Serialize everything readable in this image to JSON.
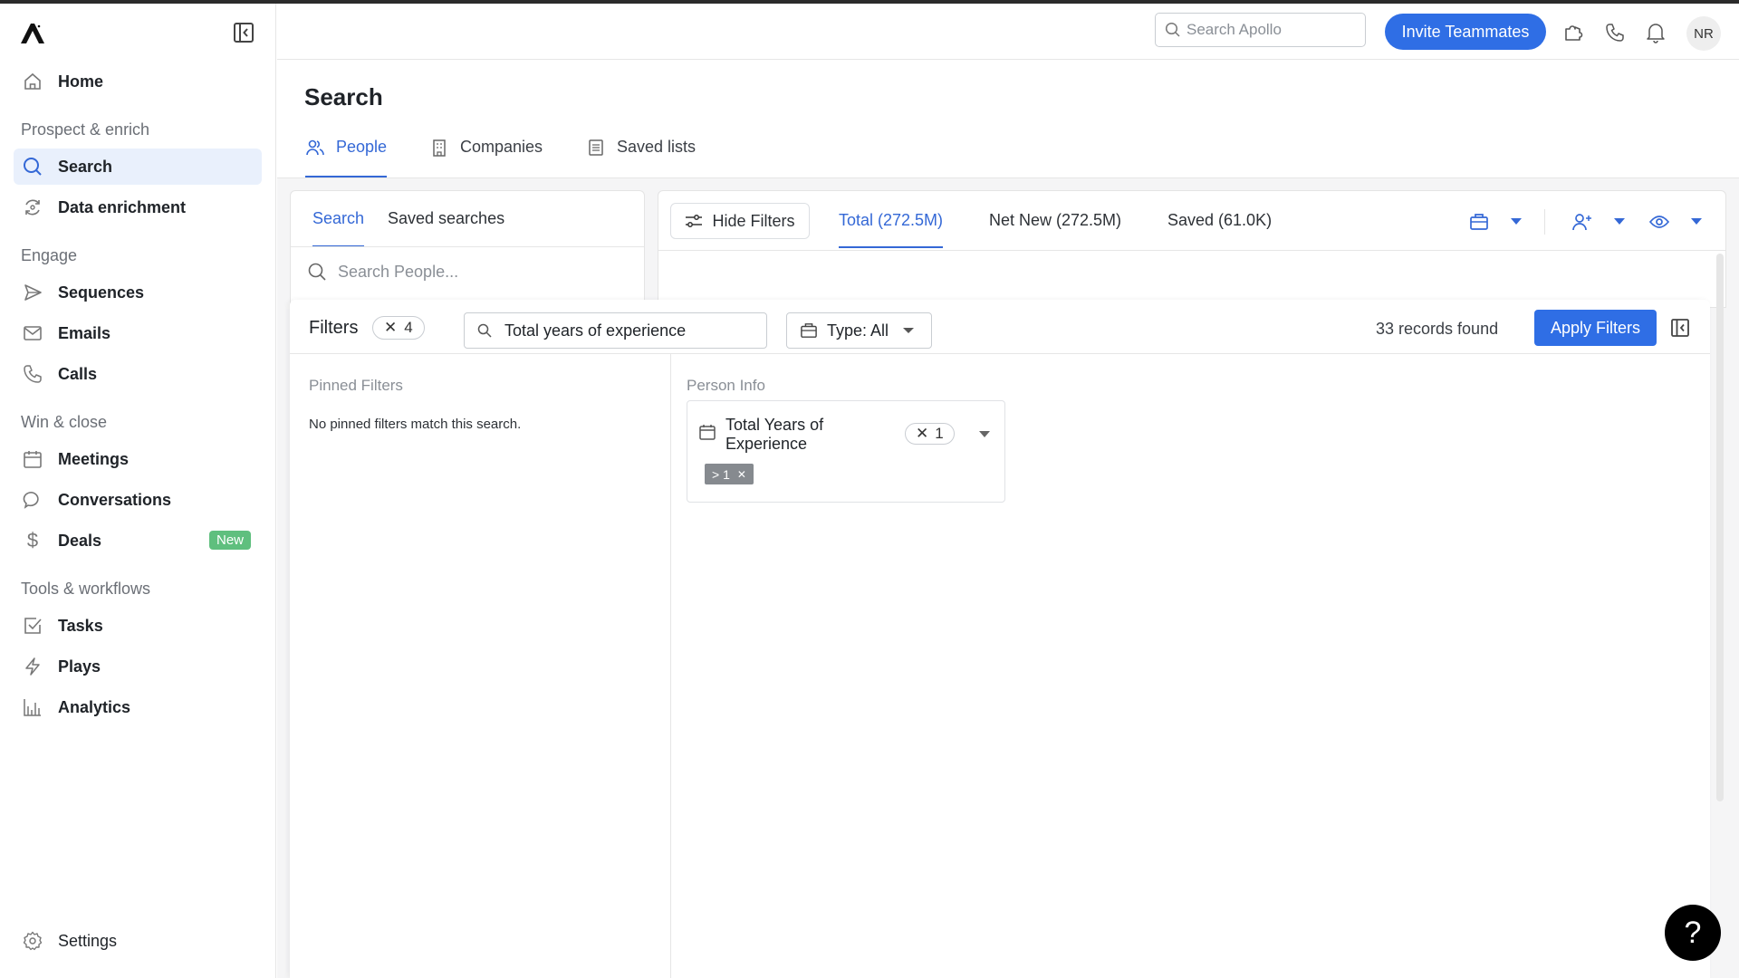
{
  "app": {
    "name": "Apollo",
    "brand_color": "#2f6ee5",
    "active_color": "#3468d6"
  },
  "sidebar": {
    "items": [
      {
        "label": "Home",
        "icon": "home-icon"
      },
      {
        "section": "Prospect & enrich"
      },
      {
        "label": "Search",
        "icon": "search-icon",
        "active": true
      },
      {
        "label": "Data enrichment",
        "icon": "data-enrichment-icon"
      },
      {
        "section": "Engage"
      },
      {
        "label": "Sequences",
        "icon": "send-icon"
      },
      {
        "label": "Emails",
        "icon": "mail-icon"
      },
      {
        "label": "Calls",
        "icon": "phone-icon"
      },
      {
        "section": "Win & close"
      },
      {
        "label": "Meetings",
        "icon": "calendar-icon"
      },
      {
        "label": "Conversations",
        "icon": "chat-bubble-icon"
      },
      {
        "label": "Deals",
        "icon": "dollar-icon",
        "badge": "New"
      },
      {
        "section": "Tools & workflows"
      },
      {
        "label": "Tasks",
        "icon": "checkbox-icon"
      },
      {
        "label": "Plays",
        "icon": "lightning-icon"
      },
      {
        "label": "Analytics",
        "icon": "bar-chart-icon"
      }
    ],
    "settings_label": "Settings"
  },
  "topbar": {
    "search_placeholder": "Search Apollo",
    "invite_label": "Invite Teammates",
    "avatar_initials": "NR"
  },
  "page": {
    "title": "Search",
    "tabs": [
      {
        "label": "People",
        "active": true
      },
      {
        "label": "Companies"
      },
      {
        "label": "Saved lists"
      }
    ]
  },
  "left_panel": {
    "tabs": [
      {
        "label": "Search",
        "active": true
      },
      {
        "label": "Saved searches"
      }
    ],
    "search_placeholder": "Search People..."
  },
  "results_panel": {
    "hide_filters_label": "Hide Filters",
    "tabs": [
      {
        "label": "Total (272.5M)",
        "active": true
      },
      {
        "label": "Net New (272.5M)"
      },
      {
        "label": "Saved (61.0K)"
      }
    ]
  },
  "filters": {
    "title": "Filters",
    "active_count": "4",
    "search_value": "Total years of experience",
    "type_label": "Type: All",
    "records_found": "33 records found",
    "apply_label": "Apply Filters",
    "pinned": {
      "title": "Pinned Filters",
      "empty_message": "No pinned filters match this search."
    },
    "person_info": {
      "title": "Person Info",
      "card": {
        "name": "Total Years of Experience",
        "count": "1",
        "chip": "> 1"
      }
    }
  },
  "help_label": "?"
}
